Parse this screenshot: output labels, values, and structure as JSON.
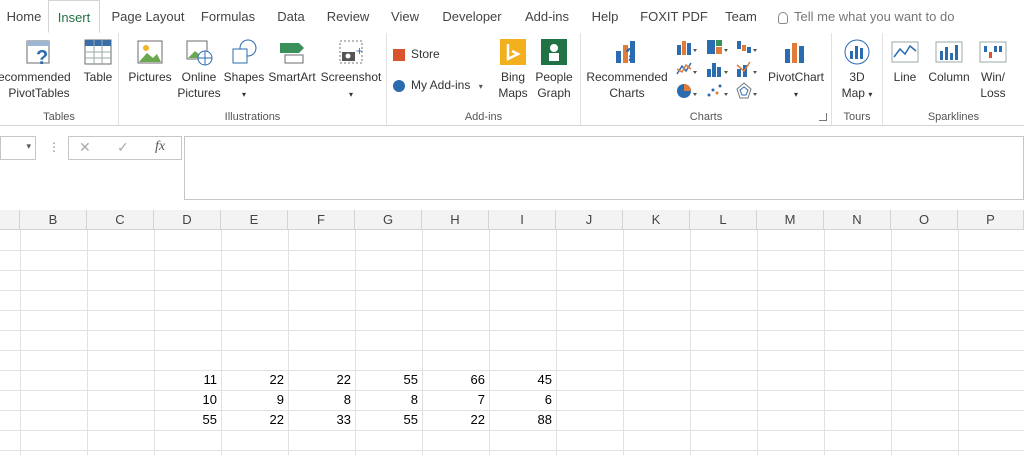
{
  "tabs": [
    "Home",
    "Insert",
    "Page Layout",
    "Formulas",
    "Data",
    "Review",
    "View",
    "Developer",
    "Add-ins",
    "Help",
    "FOXIT PDF",
    "Team"
  ],
  "tell_me": "Tell me what you want to do",
  "groups": {
    "tables": {
      "label": "Tables",
      "rec_pivot_line1": "Recommended",
      "rec_pivot_line2": "PivotTables",
      "table": "Table"
    },
    "illustrations": {
      "label": "Illustrations",
      "pictures": "Pictures",
      "online_line1": "Online",
      "online_line2": "Pictures",
      "shapes": "Shapes",
      "smartart": "SmartArt",
      "screenshot": "Screenshot"
    },
    "addins": {
      "label": "Add-ins",
      "store": "Store",
      "my_addins": "My Add-ins",
      "bing_line1": "Bing",
      "bing_line2": "Maps",
      "people_line1": "People",
      "people_line2": "Graph"
    },
    "charts": {
      "label": "Charts",
      "rec_line1": "Recommended",
      "rec_line2": "Charts",
      "pivotchart": "PivotChart"
    },
    "tours": {
      "label": "Tours",
      "map_line1": "3D",
      "map_line2": "Map"
    },
    "sparklines": {
      "label": "Sparklines",
      "line": "Line",
      "column": "Column",
      "winloss_line1": "Win/",
      "winloss_line2": "Loss"
    }
  },
  "formula_bar": {
    "fx": "fx",
    "cancel": "✕",
    "enter": "✓"
  },
  "columns": [
    "B",
    "C",
    "D",
    "E",
    "F",
    "G",
    "H",
    "I",
    "J",
    "K",
    "L",
    "M",
    "N",
    "O",
    "P"
  ],
  "rows": [
    [
      "11",
      "22",
      "22",
      "55",
      "66",
      "45"
    ],
    [
      "10",
      "9",
      "8",
      "8",
      "7",
      "6"
    ],
    [
      "55",
      "22",
      "33",
      "55",
      "22",
      "88"
    ]
  ],
  "colors": {
    "accent": "#217346"
  }
}
